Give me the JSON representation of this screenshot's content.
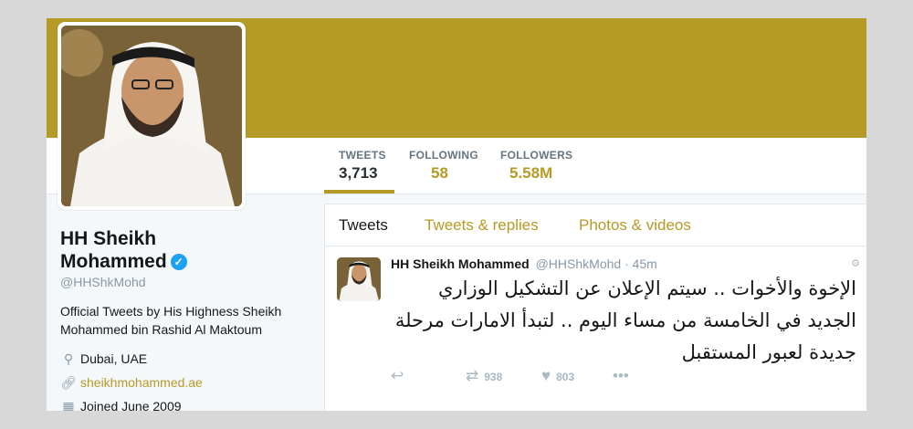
{
  "profile": {
    "name_line1": "HH Sheikh",
    "name_line2": "Mohammed",
    "handle": "@HHShkMohd",
    "bio": "Official Tweets by His Highness Sheikh Mohammed bin Rashid Al Maktoum",
    "location": "Dubai, UAE",
    "website": "sheikhmohammed.ae",
    "joined": "Joined June 2009",
    "verified_icon": "verified-badge-icon"
  },
  "stats": [
    {
      "label": "TWEETS",
      "value": "3,713"
    },
    {
      "label": "FOLLOWING",
      "value": "58"
    },
    {
      "label": "FOLLOWERS",
      "value": "5.58M"
    }
  ],
  "tabs": [
    {
      "label": "Tweets"
    },
    {
      "label": "Tweets & replies"
    },
    {
      "label": "Photos & videos"
    }
  ],
  "tweet": {
    "name": "HH Sheikh Mohammed",
    "handle": "@HHShkMohd",
    "time": "· 45m",
    "text": "الإخوة والأخوات .. سيتم الإعلان عن التشكيل الوزاري الجديد في الخامسة من مساء اليوم .. لتبدأ الامارات مرحلة جديدة لعبور المستقبل",
    "retweets": "938",
    "likes": "803"
  },
  "colors": {
    "accent": "#b59a25",
    "banner": "#b59a25",
    "verified": "#1da1f2"
  }
}
